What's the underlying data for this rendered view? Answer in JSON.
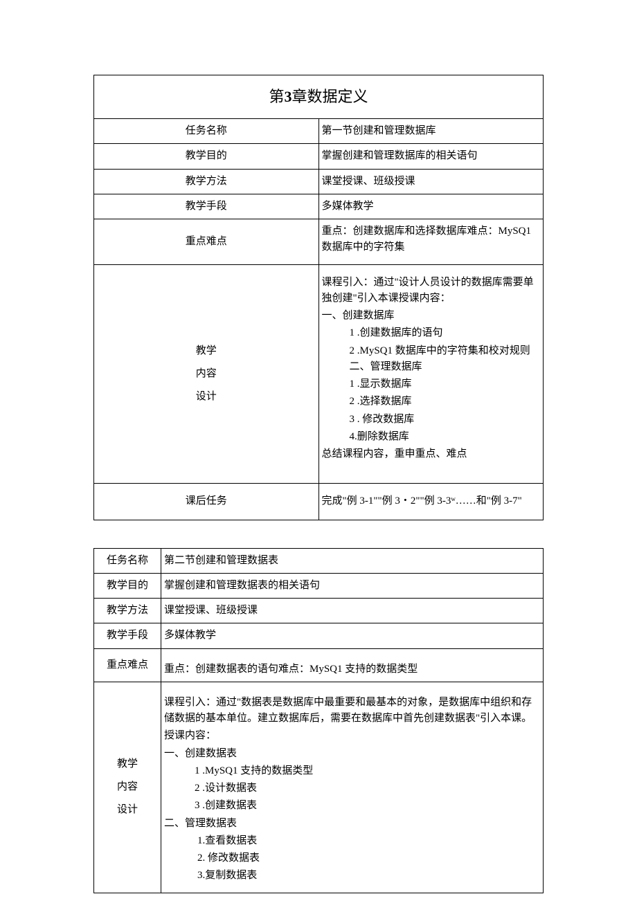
{
  "chapter_title_prefix": "第",
  "chapter_title_num": "3",
  "chapter_title_suffix": "章数据定义",
  "labels": {
    "task_name": "任务名称",
    "goal": "教学目的",
    "method": "教学方法",
    "means": "教学手段",
    "keypoint": "重点难点",
    "design_l1": "教学",
    "design_l2": "内容",
    "design_l3": "设计",
    "after": "课后任务"
  },
  "t1": {
    "task_name": "第一节创建和管理数据库",
    "goal": "掌握创建和管理数据库的相关语句",
    "method": "课堂授课、班级授课",
    "means": "多媒体教学",
    "keypoint": "重点：创建数据库和选择数据库难点：MySQ1 数据库中的字符集",
    "c0": "课程引入：通过\"设计人员设计的数据库需要单独创建\"引入本课授课内容：",
    "c1": "一、创建数据库",
    "c2": "1 .创建数据库的语句",
    "c3": "2 .MySQ1 数据库中的字符集和校对规则二、管理数据库",
    "c4": "1 .显示数据库",
    "c5": "2 .选择数据库",
    "c6": "3 . 修改数据库",
    "c7": "4.删除数据库",
    "c8": "总结课程内容，重申重点、难点",
    "after": "完成\"例 3-1\"\"例 3・2\"\"例 3-3ʷ……和\"例 3-7\""
  },
  "t2": {
    "task_name": "第二节创建和管理数据表",
    "goal": "掌握创建和管理数据表的相关语句",
    "method": "课堂授课、班级授课",
    "means": "多媒体教学",
    "keypoint": "重点：创建数据表的语句难点：MySQ1 支持的数据类型",
    "c0": "课程引入：通过\"数据表是数据库中最重要和最基本的对象，是数据库中组织和存储数据的基本单位。建立数据库后，需要在数据库中首先创建数据表\"引入本课。",
    "c1": "授课内容：",
    "c2": "一、创建数据表",
    "c3": "1 .MySQ1 支持的数据类型",
    "c4": "2 .设计数据表",
    "c5": "3 .创建数据表",
    "c6": "二、管理数据表",
    "c7": "1.查看数据表",
    "c8": "2. 修改数据表",
    "c9": "3.复制数据表"
  }
}
